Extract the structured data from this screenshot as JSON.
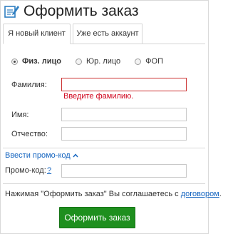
{
  "header": {
    "title": "Оформить заказ",
    "icon": "edit-order-icon"
  },
  "tabs": [
    {
      "label": "Я новый клиент",
      "active": true
    },
    {
      "label": "Уже есть аккаунт",
      "active": false
    }
  ],
  "customer_type": {
    "options": [
      "Физ. лицо",
      "Юр. лицо",
      "ФОП"
    ],
    "selected": "Физ. лицо"
  },
  "form": {
    "surname": {
      "label": "Фамилия:",
      "value": "",
      "error": "Введите фамилию."
    },
    "name": {
      "label": "Имя:",
      "value": ""
    },
    "patronymic": {
      "label": "Отчество:",
      "value": ""
    }
  },
  "promo": {
    "toggle_label": "Ввести промо-код",
    "label": "Промо-код:",
    "help": "?",
    "value": ""
  },
  "agreement": {
    "text": "Нажимая \"Оформить заказ\" Вы соглашаетесь с",
    "link": "договором",
    "suffix": "."
  },
  "submit_label": "Оформить заказ",
  "colors": {
    "accent_green": "#1e8f1e",
    "link_blue": "#1565c0",
    "error_red": "#d0021b"
  }
}
